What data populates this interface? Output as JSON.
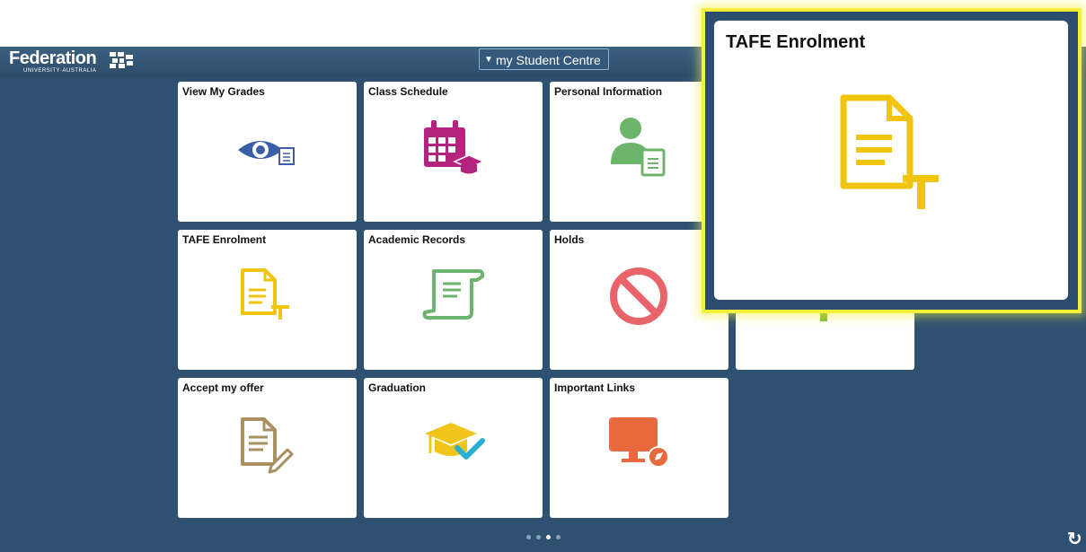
{
  "header": {
    "logo_word": "Federation",
    "logo_sub": "UNIVERSITY·AUSTRALIA",
    "nav_label": "my Student Centre"
  },
  "tiles": [
    {
      "label": "View My Grades",
      "icon": "eye-document-icon"
    },
    {
      "label": "Class Schedule",
      "icon": "calendar-graduation-icon"
    },
    {
      "label": "Personal Information",
      "icon": "person-document-icon"
    },
    {
      "label": "TAFE Enrolment",
      "icon": "document-t-icon"
    },
    {
      "label": "Academic Records",
      "icon": "scroll-icon"
    },
    {
      "label": "Holds",
      "icon": "prohibited-icon"
    },
    {
      "label": "Accept my offer",
      "icon": "document-pencil-icon"
    },
    {
      "label": "Graduation",
      "icon": "graduation-cap-check-icon"
    },
    {
      "label": "Important Links",
      "icon": "monitor-compass-icon"
    }
  ],
  "popup": {
    "label": "TAFE Enrolment",
    "icon": "document-t-icon"
  },
  "pagination": {
    "total": 4,
    "current": 3
  },
  "colors": {
    "header": "#2c4b68",
    "background": "#2e5171",
    "highlight": "#f2f23a",
    "grades_icon": "#3b5eab",
    "schedule_icon": "#b4247e",
    "person_icon": "#6cb56a",
    "tafe_icon": "#f1c40f",
    "records_icon": "#6bb36f",
    "holds_icon": "#e8636a",
    "offer_icon": "#a99060",
    "graduation_icon": "#f0c419",
    "links_icon": "#e9693f"
  }
}
